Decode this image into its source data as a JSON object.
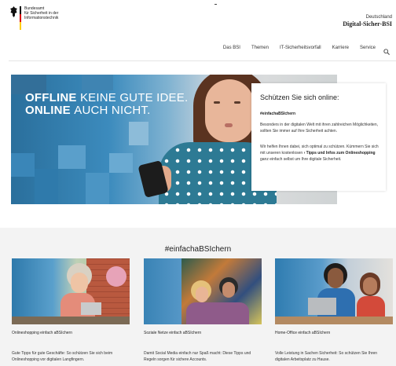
{
  "header": {
    "logo_lines": [
      "Bundesamt",
      "für Sicherheit in der",
      "Informationstechnik"
    ],
    "brand_top": "Deutschland",
    "brand_bottom": "Digital-Sicher-BSI",
    "nav": [
      "Das BSI",
      "Themen",
      "IT-Sicherheitsvorfall",
      "Karriere",
      "Service"
    ],
    "search_icon": "search-icon"
  },
  "hero": {
    "headline_line1_a": "OFFLINE",
    "headline_line1_b": "KEINE GUTE IDEE.",
    "headline_line2_a": "ONLINE",
    "headline_line2_b": "AUCH NICHT."
  },
  "hero_card": {
    "title": "Schützen Sie sich online:",
    "hashtag": "#einfachaBSIchern",
    "para1": "Besonders in der digitalen Welt mit ihren zahlreichen Möglichkeiten, sollten Sie immer auf Ihre Sicherheit achten.",
    "para2_start": "Wir helfen Ihnen dabei, sich optimal zu schützen. Kümmern Sie sich mit unseren kostenlosen",
    "para2_link": "› Tipps und Infos zum Onlineshopping",
    "para2_end": "ganz einfach selbst um Ihre digitale Sicherheit."
  },
  "section": {
    "title": "#einfachaBSIchern",
    "cards": [
      {
        "caption": "Onlineshopping einfach aBSIchern",
        "desc": "Gute Tipps für gute Geschäfte: So schützen Sie sich beim Onlineshopping vor digitalen Langfingern."
      },
      {
        "caption": "Soziale Netze einfach aBSIchern",
        "desc": "Damit Social Media einfach nur Spaß macht: Diese Tipps und Regeln sorgen für sichere Accounts."
      },
      {
        "caption": "Home-Office einfach aBSIchern",
        "desc": "Volle Leistung in Sachen Sicherheit: So schützen Sie Ihren digitalen Arbeitsplatz zu Hause."
      }
    ]
  },
  "colors": {
    "hero_blue": "#2a6f9c",
    "pixel_blue": "#3c8bbd",
    "band_bg": "#f3f3f3",
    "flag_black": "#000000",
    "flag_red": "#dd0000",
    "flag_gold": "#ffce00"
  }
}
